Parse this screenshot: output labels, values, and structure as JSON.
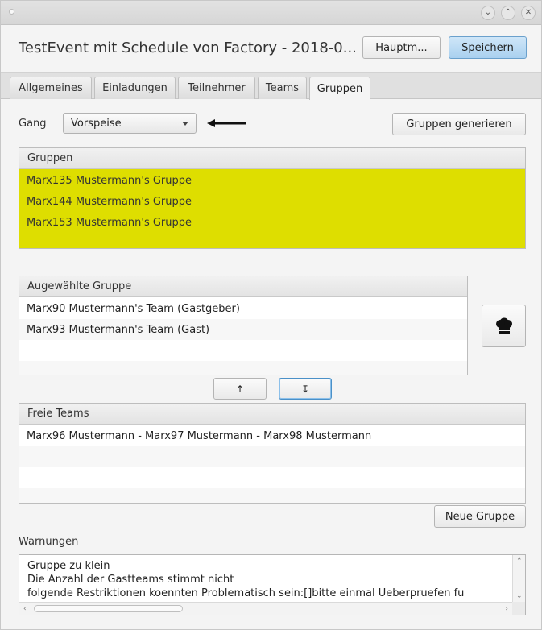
{
  "window": {
    "title_controls": [
      "⌄",
      "⌃",
      "✕"
    ]
  },
  "header": {
    "title": "TestEvent mit Schedule von Factory - 2018-0...",
    "main_button": "Hauptm...",
    "save_button": "Speichern"
  },
  "tabs": [
    {
      "label": "Allgemeines"
    },
    {
      "label": "Einladungen"
    },
    {
      "label": "Teilnehmer"
    },
    {
      "label": "Teams"
    },
    {
      "label": "Gruppen"
    }
  ],
  "active_tab": "Gruppen",
  "gang": {
    "label": "Gang",
    "selected": "Vorspeise"
  },
  "generate_button": "Gruppen generieren",
  "groups_panel": {
    "header": "Gruppen",
    "highlight_color": "#dede00",
    "items": [
      "Marx135 Mustermann's Gruppe",
      "Marx144 Mustermann's Gruppe",
      "Marx153 Mustermann's Gruppe"
    ]
  },
  "selected_group_panel": {
    "header": "Augewählte Gruppe",
    "items": [
      "Marx90 Mustermann's Team (Gastgeber)",
      "Marx93 Mustermann's Team (Gast)"
    ]
  },
  "chef_button_icon": "chef-hat-icon",
  "move_up_icon": "↥",
  "move_down_icon": "↧",
  "free_teams_panel": {
    "header": "Freie Teams",
    "items": [
      "Marx96 Mustermann - Marx97 Mustermann - Marx98 Mustermann"
    ]
  },
  "new_group_button": "Neue Gruppe",
  "warnings": {
    "label": "Warnungen",
    "lines": [
      "Gruppe zu klein",
      "Die Anzahl der Gastteams stimmt nicht",
      "folgende Restriktionen koennten Problematisch sein:[]bitte einmal Ueberpruefen fu"
    ]
  }
}
